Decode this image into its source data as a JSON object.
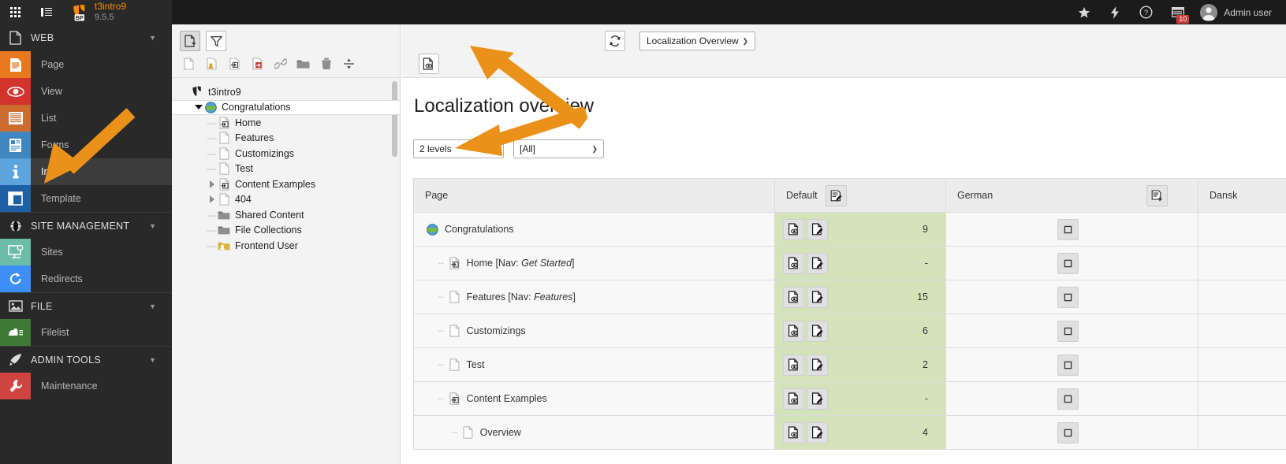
{
  "topbar": {
    "modules_icon": "grid-icon",
    "list_icon": "list-icon",
    "brand_title": "t3intro9",
    "brand_version": "9.5.5",
    "tools": [
      {
        "name": "bookmarks-icon",
        "label": "star"
      },
      {
        "name": "clear-cache-icon",
        "label": "bolt"
      },
      {
        "name": "help-icon",
        "label": "question"
      },
      {
        "name": "systeminformation-icon",
        "label": "info",
        "badge": "10"
      }
    ],
    "user_name": "Admin user"
  },
  "sidebar": {
    "sections": [
      {
        "id": "web",
        "label": "WEB",
        "icon": "page-icon",
        "items": [
          {
            "id": "page",
            "label": "Page",
            "icon": "page-module-icon",
            "color": "#e8791e",
            "active": false
          },
          {
            "id": "view",
            "label": "View",
            "icon": "eye-icon",
            "color": "#d0342c",
            "active": false
          },
          {
            "id": "list",
            "label": "List",
            "icon": "list-module-icon",
            "color": "#cb6c2c",
            "active": false
          },
          {
            "id": "forms",
            "label": "Forms",
            "icon": "forms-icon",
            "color": "#3f87c0",
            "active": false
          },
          {
            "id": "info",
            "label": "Info",
            "icon": "info-icon",
            "color": "#5ba4dd",
            "active": true
          },
          {
            "id": "template",
            "label": "Template",
            "icon": "template-icon",
            "color": "#1f5fa6",
            "active": false
          }
        ]
      },
      {
        "id": "site-management",
        "label": "SITE MANAGEMENT",
        "icon": "globe-icon",
        "items": [
          {
            "id": "sites",
            "label": "Sites",
            "icon": "sites-icon",
            "color": "#6bbda7",
            "active": false
          },
          {
            "id": "redirects",
            "label": "Redirects",
            "icon": "redirect-icon",
            "color": "#3d8ef7",
            "active": false
          }
        ]
      },
      {
        "id": "file",
        "label": "FILE",
        "icon": "image-icon",
        "items": [
          {
            "id": "filelist",
            "label": "Filelist",
            "icon": "filelist-icon",
            "color": "#3e7a36",
            "active": false
          }
        ]
      },
      {
        "id": "admin-tools",
        "label": "ADMIN TOOLS",
        "icon": "rocket-icon",
        "items": [
          {
            "id": "maintenance",
            "label": "Maintenance",
            "icon": "wrench-icon",
            "color": "#cf4440",
            "active": false
          }
        ]
      }
    ]
  },
  "tree_toolbar": {
    "new_page_icon": "new-page-icon",
    "filter_icon": "filter-icon",
    "actions": [
      {
        "name": "new-page-doc-icon"
      },
      {
        "name": "new-page-user-icon"
      },
      {
        "name": "new-shortcut-icon"
      },
      {
        "name": "new-page-link-red-icon"
      },
      {
        "name": "link-icon"
      },
      {
        "name": "folder-icon"
      },
      {
        "name": "trash-icon"
      },
      {
        "name": "divider-icon"
      }
    ]
  },
  "tree": {
    "nodes": [
      {
        "label": "t3intro9",
        "depth": 0,
        "icon": "typo3-root-icon",
        "toggle": "none",
        "selected": false
      },
      {
        "label": "Congratulations",
        "depth": 1,
        "icon": "globe-page-icon",
        "toggle": "expanded",
        "selected": true
      },
      {
        "label": "Home",
        "depth": 2,
        "icon": "shortcut-page-icon",
        "toggle": "leaf",
        "selected": false
      },
      {
        "label": "Features",
        "depth": 2,
        "icon": "page-doc-icon",
        "toggle": "leaf",
        "selected": false
      },
      {
        "label": "Customizings",
        "depth": 2,
        "icon": "page-doc-icon",
        "toggle": "leaf",
        "selected": false
      },
      {
        "label": "Test",
        "depth": 2,
        "icon": "page-doc-icon",
        "toggle": "leaf",
        "selected": false
      },
      {
        "label": "Content Examples",
        "depth": 2,
        "icon": "shortcut-page-icon",
        "toggle": "collapsed",
        "selected": false
      },
      {
        "label": "404",
        "depth": 2,
        "icon": "page-doc-icon",
        "toggle": "collapsed",
        "selected": false
      },
      {
        "label": "Shared Content",
        "depth": 2,
        "icon": "folder-icon",
        "toggle": "leaf",
        "selected": false
      },
      {
        "label": "File Collections",
        "depth": 2,
        "icon": "folder-icon",
        "toggle": "leaf",
        "selected": false
      },
      {
        "label": "Frontend User",
        "depth": 2,
        "icon": "folder-user-icon",
        "toggle": "leaf",
        "selected": false
      }
    ]
  },
  "main_toolbar": {
    "refresh_icon": "refresh-icon",
    "module_select": "Localization Overview",
    "preview_icon": "view-webpage-icon"
  },
  "content": {
    "title": "Localization overview",
    "depth_filter": "2 levels",
    "lang_filter": "[All]"
  },
  "table": {
    "columns": [
      {
        "id": "page",
        "label": "Page",
        "action_icon": null
      },
      {
        "id": "default",
        "label": "Default",
        "action_icon": "edit-multiple-icon"
      },
      {
        "id": "german",
        "label": "German",
        "action_icon": "new-translation-icon"
      },
      {
        "id": "dansk",
        "label": "Dansk",
        "action_icon": null
      }
    ],
    "rows": [
      {
        "label": "Congratulations",
        "nav": null,
        "depth": 0,
        "icon": "globe-page-icon",
        "count": "9"
      },
      {
        "label": "Home",
        "nav": "Get Started",
        "depth": 1,
        "icon": "shortcut-page-icon",
        "count": "-"
      },
      {
        "label": "Features",
        "nav": "Features",
        "depth": 1,
        "icon": "page-doc-icon",
        "count": "15"
      },
      {
        "label": "Customizings",
        "nav": null,
        "depth": 1,
        "icon": "page-doc-icon",
        "count": "6"
      },
      {
        "label": "Test",
        "nav": null,
        "depth": 1,
        "icon": "page-doc-icon",
        "count": "2"
      },
      {
        "label": "Content Examples",
        "nav": null,
        "depth": 1,
        "icon": "shortcut-page-icon",
        "count": "-"
      },
      {
        "label": "Overview",
        "nav": null,
        "depth": 2,
        "icon": "page-doc-icon",
        "count": "4"
      }
    ],
    "row_actions": [
      "view-page-icon",
      "edit-page-icon"
    ],
    "lang_cell_action": "new-translation-small-icon"
  },
  "annotations": {
    "arrow_color": "#eb9119",
    "arrows": [
      {
        "name": "arrow-to-module-select"
      },
      {
        "name": "arrow-to-depth-filter"
      },
      {
        "name": "arrow-to-info-module"
      }
    ]
  }
}
